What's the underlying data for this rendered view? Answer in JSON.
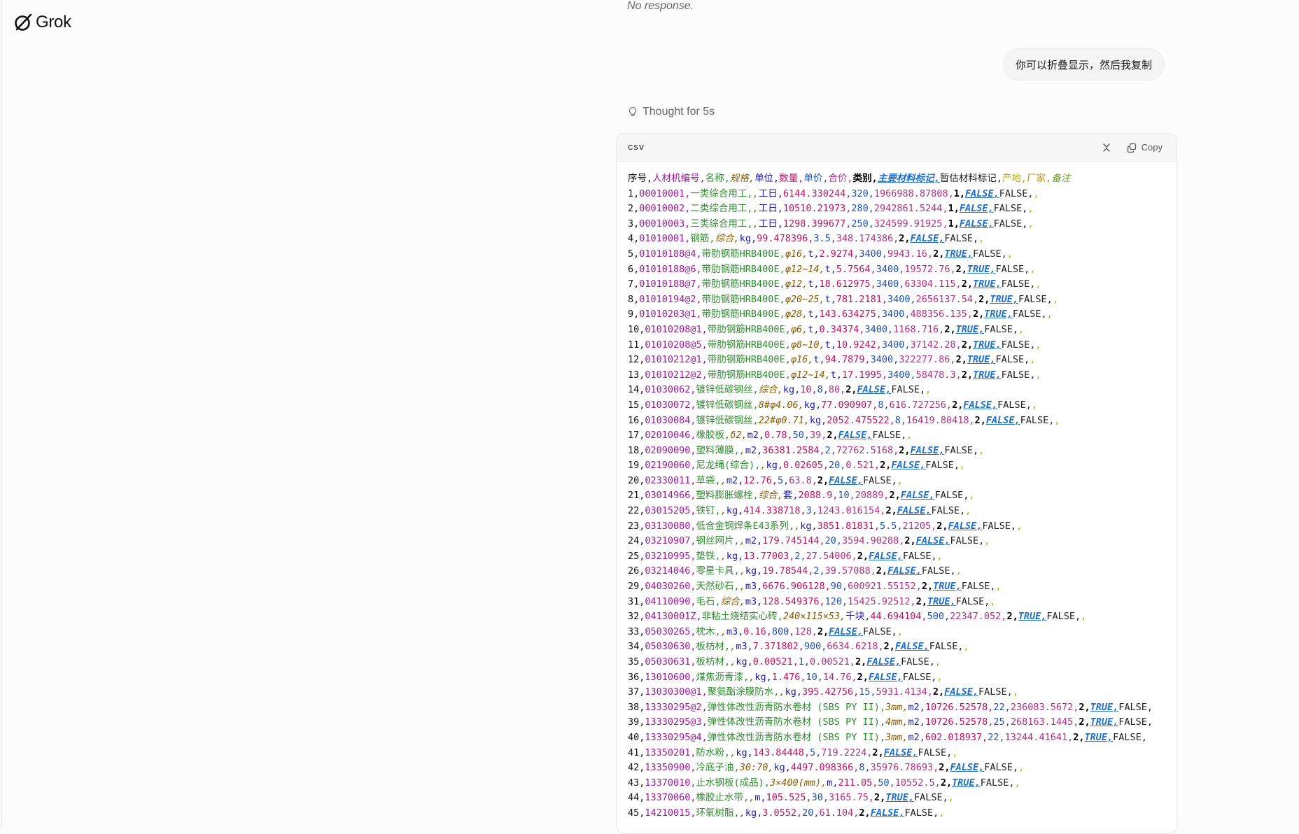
{
  "app": {
    "name": "Grok"
  },
  "conversation": {
    "previous_response": "No response.",
    "user_message": "你可以折叠显示，然后我复制",
    "thought_label": "Thought for 5s"
  },
  "code_block": {
    "language": "csv",
    "copy_label": "Copy",
    "header": [
      "序号",
      "人材机编号",
      "名称",
      "规格",
      "单位",
      "数量",
      "单价",
      "合价",
      "类别",
      "主要材料标记",
      "暂估材料标记",
      "产地",
      "厂家",
      "备注"
    ],
    "rows": [
      [
        "1",
        "00010001",
        "一类综合用工",
        "",
        "工日",
        "6144.330244",
        "320",
        "1966988.87808",
        "1",
        "FALSE",
        "FALSE",
        "",
        ""
      ],
      [
        "2",
        "00010002",
        "二类综合用工",
        "",
        "工日",
        "10510.21973",
        "280",
        "2942861.5244",
        "1",
        "FALSE",
        "FALSE",
        "",
        ""
      ],
      [
        "3",
        "00010003",
        "三类综合用工",
        "",
        "工日",
        "1298.399677",
        "250",
        "324599.91925",
        "1",
        "FALSE",
        "FALSE",
        "",
        ""
      ],
      [
        "4",
        "01010001",
        "钢筋",
        "综合",
        "kg",
        "99.478396",
        "3.5",
        "348.174386",
        "2",
        "FALSE",
        "FALSE",
        "",
        ""
      ],
      [
        "5",
        "01010188@4",
        "带肋钢筋HRB400E",
        "φ16",
        "t",
        "2.9274",
        "3400",
        "9943.16",
        "2",
        "TRUE",
        "FALSE",
        "",
        ""
      ],
      [
        "6",
        "01010188@6",
        "带肋钢筋HRB400E",
        "φ12~14",
        "t",
        "5.7564",
        "3400",
        "19572.76",
        "2",
        "TRUE",
        "FALSE",
        "",
        ""
      ],
      [
        "7",
        "01010188@7",
        "带肋钢筋HRB400E",
        "φ12",
        "t",
        "18.612975",
        "3400",
        "63304.115",
        "2",
        "TRUE",
        "FALSE",
        "",
        ""
      ],
      [
        "8",
        "01010194@2",
        "带肋钢筋HRB400E",
        "φ20~25",
        "t",
        "781.2181",
        "3400",
        "2656137.54",
        "2",
        "TRUE",
        "FALSE",
        "",
        ""
      ],
      [
        "9",
        "01010203@1",
        "带肋钢筋HRB400E",
        "φ28",
        "t",
        "143.634275",
        "3400",
        "488356.135",
        "2",
        "TRUE",
        "FALSE",
        "",
        ""
      ],
      [
        "10",
        "01010208@1",
        "带肋钢筋HRB400E",
        "φ6",
        "t",
        "0.34374",
        "3400",
        "1168.716",
        "2",
        "TRUE",
        "FALSE",
        "",
        ""
      ],
      [
        "11",
        "01010208@5",
        "带肋钢筋HRB400E",
        "φ8~10",
        "t",
        "10.9242",
        "3400",
        "37142.28",
        "2",
        "TRUE",
        "FALSE",
        "",
        ""
      ],
      [
        "12",
        "01010212@1",
        "带肋钢筋HRB400E",
        "φ16",
        "t",
        "94.7879",
        "3400",
        "322277.86",
        "2",
        "TRUE",
        "FALSE",
        "",
        ""
      ],
      [
        "13",
        "01010212@2",
        "带肋钢筋HRB400E",
        "φ12~14",
        "t",
        "17.1995",
        "3400",
        "58478.3",
        "2",
        "TRUE",
        "FALSE",
        "",
        ""
      ],
      [
        "14",
        "01030062",
        "镀锌低碳钢丝",
        "综合",
        "kg",
        "10",
        "8",
        "80",
        "2",
        "FALSE",
        "FALSE",
        "",
        ""
      ],
      [
        "15",
        "01030072",
        "镀锌低碳钢丝",
        "8#φ4.06",
        "kg",
        "77.090907",
        "8",
        "616.727256",
        "2",
        "FALSE",
        "FALSE",
        "",
        ""
      ],
      [
        "16",
        "01030084",
        "镀锌低碳钢丝",
        "22#φ0.71",
        "kg",
        "2052.475522",
        "8",
        "16419.80418",
        "2",
        "FALSE",
        "FALSE",
        "",
        ""
      ],
      [
        "17",
        "02010046",
        "橡胶板",
        "δ2",
        "m2",
        "0.78",
        "50",
        "39",
        "2",
        "FALSE",
        "FALSE",
        "",
        ""
      ],
      [
        "18",
        "02090090",
        "塑料薄膜",
        "",
        "m2",
        "36381.2584",
        "2",
        "72762.5168",
        "2",
        "FALSE",
        "FALSE",
        "",
        ""
      ],
      [
        "19",
        "02190060",
        "尼龙绳(综合)",
        "",
        "kg",
        "0.02605",
        "20",
        "0.521",
        "2",
        "FALSE",
        "FALSE",
        "",
        ""
      ],
      [
        "20",
        "02330011",
        "草袋",
        "",
        "m2",
        "12.76",
        "5",
        "63.8",
        "2",
        "FALSE",
        "FALSE",
        "",
        ""
      ],
      [
        "21",
        "03014966",
        "塑料膨胀螺栓",
        "综合",
        "套",
        "2088.9",
        "10",
        "20889",
        "2",
        "FALSE",
        "FALSE",
        "",
        ""
      ],
      [
        "22",
        "03015205",
        "铁钉",
        "",
        "kg",
        "414.338718",
        "3",
        "1243.016154",
        "2",
        "FALSE",
        "FALSE",
        "",
        ""
      ],
      [
        "23",
        "03130080",
        "低合金钢焊条E43系列",
        "",
        "kg",
        "3851.81831",
        "5.5",
        "21205",
        "2",
        "FALSE",
        "FALSE",
        "",
        ""
      ],
      [
        "24",
        "03210907",
        "钢丝网片",
        "",
        "m2",
        "179.745144",
        "20",
        "3594.90288",
        "2",
        "FALSE",
        "FALSE",
        "",
        ""
      ],
      [
        "25",
        "03210995",
        "垫铁",
        "",
        "kg",
        "13.77003",
        "2",
        "27.54006",
        "2",
        "FALSE",
        "FALSE",
        "",
        ""
      ],
      [
        "26",
        "03214046",
        "零星卡具",
        "",
        "kg",
        "19.78544",
        "2",
        "39.57088",
        "2",
        "FALSE",
        "FALSE",
        "",
        ""
      ],
      [
        "29",
        "04030260",
        "天然砂石",
        "",
        "m3",
        "6676.906128",
        "90",
        "600921.55152",
        "2",
        "TRUE",
        "FALSE",
        "",
        ""
      ],
      [
        "31",
        "04110090",
        "毛石",
        "综合",
        "m3",
        "128.549376",
        "120",
        "15425.92512",
        "2",
        "TRUE",
        "FALSE",
        "",
        ""
      ],
      [
        "32",
        "04130001Z",
        "非粘土烧结实心砖",
        "240×115×53",
        "千块",
        "44.694104",
        "500",
        "22347.052",
        "2",
        "TRUE",
        "FALSE",
        "",
        ""
      ],
      [
        "33",
        "05030265",
        "枕木",
        "",
        "m3",
        "0.16",
        "800",
        "128",
        "2",
        "FALSE",
        "FALSE",
        "",
        ""
      ],
      [
        "34",
        "05030630",
        "板枋材",
        "",
        "m3",
        "7.371802",
        "900",
        "6634.6218",
        "2",
        "FALSE",
        "FALSE",
        "",
        ""
      ],
      [
        "35",
        "05030631",
        "板枋材",
        "",
        "kg",
        "0.00521",
        "1",
        "0.00521",
        "2",
        "FALSE",
        "FALSE",
        "",
        ""
      ],
      [
        "36",
        "13010600",
        "煤焦沥青漆",
        "",
        "kg",
        "1.476",
        "10",
        "14.76",
        "2",
        "FALSE",
        "FALSE",
        "",
        ""
      ],
      [
        "37",
        "13030300@1",
        "聚氨酯涂膜防水",
        "",
        "kg",
        "395.42756",
        "15",
        "5931.4134",
        "2",
        "FALSE",
        "FALSE",
        "",
        ""
      ],
      [
        "38",
        "13330295@2",
        "弹性体改性沥青防水卷材 (SBS PY II)",
        "3mm",
        "m2",
        "10726.52578",
        "22",
        "236083.5672",
        "2",
        "TRUE",
        "FALSE",
        ""
      ],
      [
        "39",
        "13330295@3",
        "弹性体改性沥青防水卷材 (SBS PY II)",
        "4mm",
        "m2",
        "10726.52578",
        "25",
        "268163.1445",
        "2",
        "TRUE",
        "FALSE",
        ""
      ],
      [
        "40",
        "13330295@4",
        "弹性体改性沥青防水卷材 (SBS PY II)",
        "3mm",
        "m2",
        "602.018937",
        "22",
        "13244.41641",
        "2",
        "TRUE",
        "FALSE",
        ""
      ],
      [
        "41",
        "13350201",
        "防水粉",
        "",
        "kg",
        "143.84448",
        "5",
        "719.2224",
        "2",
        "FALSE",
        "FALSE",
        "",
        ""
      ],
      [
        "42",
        "13350900",
        "冷底子油",
        "30:70",
        "kg",
        "4497.098366",
        "8",
        "35976.78693",
        "2",
        "FALSE",
        "FALSE",
        "",
        ""
      ],
      [
        "43",
        "13370010",
        "止水钢板(成品)",
        "3×400(mm)",
        "m",
        "211.05",
        "50",
        "10552.5",
        "2",
        "TRUE",
        "FALSE",
        "",
        ""
      ],
      [
        "44",
        "13370060",
        "橡胶止水带",
        "",
        "m",
        "105.525",
        "30",
        "3165.75",
        "2",
        "TRUE",
        "FALSE",
        "",
        ""
      ],
      [
        "45",
        "14210015",
        "环氧树脂",
        "",
        "kg",
        "3.0552",
        "20",
        "61.104",
        "2",
        "FALSE",
        "FALSE",
        "",
        ""
      ]
    ]
  }
}
